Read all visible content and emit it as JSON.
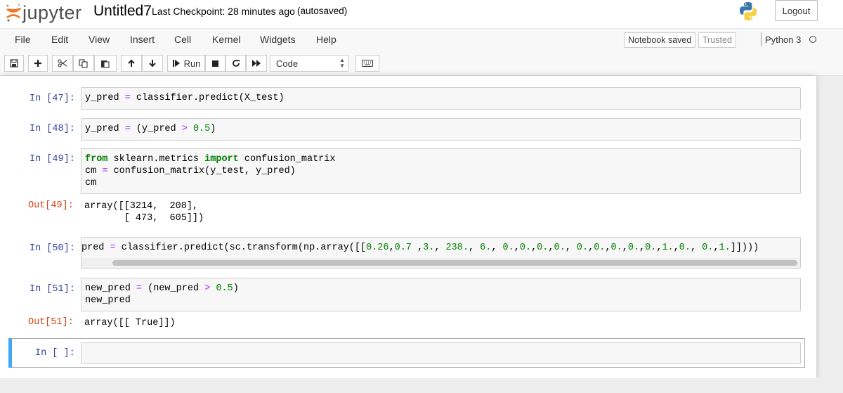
{
  "header": {
    "logo_text": "jupyter",
    "notebook_title": "Untitled7",
    "checkpoint": "Last Checkpoint: 28 minutes ago",
    "autosave": "(autosaved)",
    "logout_label": "Logout"
  },
  "menu": {
    "items": [
      "File",
      "Edit",
      "View",
      "Insert",
      "Cell",
      "Kernel",
      "Widgets",
      "Help"
    ],
    "notebook_status": "Notebook saved",
    "trusted": "Trusted",
    "kernel": "Python 3"
  },
  "toolbar": {
    "run_label": "Run",
    "cell_type": "Code"
  },
  "cells": [
    {
      "prompt": "In [47]:",
      "code": "y_pred = classifier.predict(X_test)"
    },
    {
      "prompt": "In [48]:",
      "code": "y_pred = (y_pred > 0.5)"
    },
    {
      "prompt": "In [49]:",
      "code": "from sklearn.metrics import confusion_matrix\ncm = confusion_matrix(y_test, y_pred)\ncm",
      "out_prompt": "Out[49]:",
      "output": "array([[3214,  208],\n       [ 473,  605]])"
    },
    {
      "prompt": "In [50]:",
      "code": "pred = classifier.predict(sc.transform(np.array([[0.26,0.7 ,3., 238., 6., 0.,0.,0.,0., 0.,0.,0.,0.,0.,1.,0., 0.,1.]])))"
    },
    {
      "prompt": "In [51]:",
      "code": "new_pred = (new_pred > 0.5)\nnew_pred",
      "out_prompt": "Out[51]:",
      "output": "array([[ True]])"
    },
    {
      "prompt": "In [ ]:",
      "code": ""
    }
  ]
}
